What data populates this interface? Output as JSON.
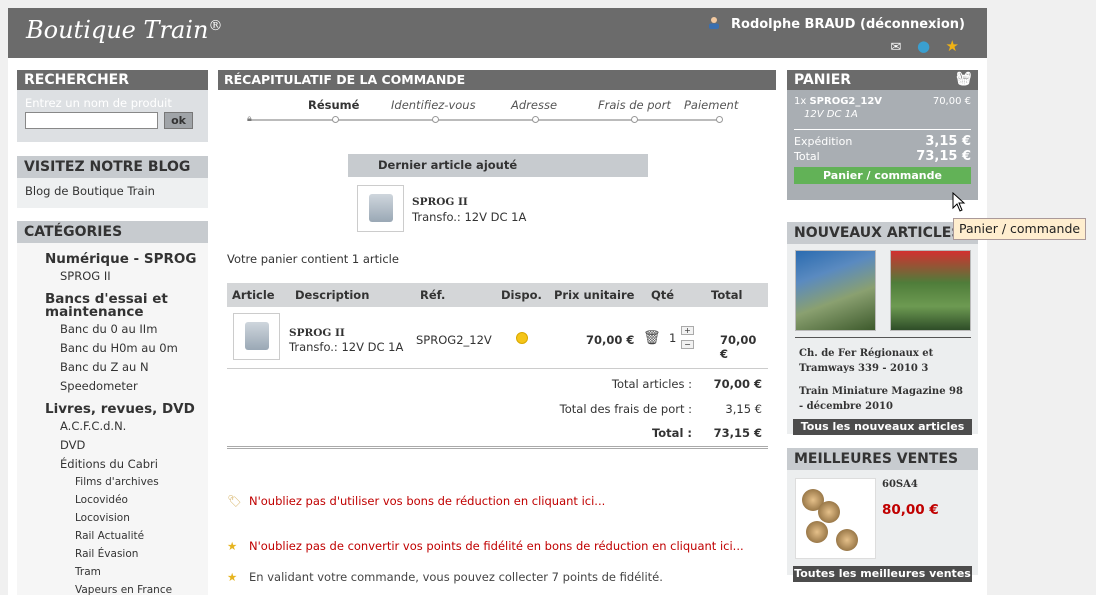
{
  "header": {
    "logo": "Boutique Train",
    "logo_mark": "®",
    "user_name": "Rodolphe BRAUD",
    "logout": "(déconnexion)",
    "icons": [
      "user-icon",
      "mail-icon",
      "globe-icon",
      "star-icon"
    ]
  },
  "search": {
    "title": "RECHERCHER",
    "label": "Entrez un nom de produit",
    "value": "",
    "button": "ok"
  },
  "blog": {
    "title": "VISITEZ NOTRE BLOG",
    "link": "Blog de Boutique Train"
  },
  "categories": {
    "title": "CATÉGORIES",
    "items": [
      {
        "label": "Numérique - SPROG",
        "level": 1
      },
      {
        "label": "SPROG II",
        "level": 2
      },
      {
        "label": "Bancs d'essai et maintenance",
        "level": 1
      },
      {
        "label": "Banc du 0 au IIm",
        "level": 2
      },
      {
        "label": "Banc du H0m au 0m",
        "level": 2
      },
      {
        "label": "Banc du Z au N",
        "level": 2
      },
      {
        "label": "Speedometer",
        "level": 2
      },
      {
        "label": "Livres, revues, DVD",
        "level": 1
      },
      {
        "label": "A.C.F.C.d.N.",
        "level": 2
      },
      {
        "label": "DVD",
        "level": 2
      },
      {
        "label": "Éditions du Cabri",
        "level": 2
      },
      {
        "label": "Films d'archives",
        "level": 3
      },
      {
        "label": "Locovidéo",
        "level": 3
      },
      {
        "label": "Locovision",
        "level": 3
      },
      {
        "label": "Rail Actualité",
        "level": 3
      },
      {
        "label": "Rail Évasion",
        "level": 3
      },
      {
        "label": "Tram",
        "level": 3
      },
      {
        "label": "Vapeurs en France",
        "level": 3
      }
    ]
  },
  "summary": {
    "title": "RÉCAPITULATIF DE LA COMMANDE",
    "steps": [
      "Résumé",
      "Identifiez-vous",
      "Adresse",
      "Frais de port",
      "Paiement"
    ],
    "last_added_title": "Dernier article ajouté",
    "last_added_name": "SPROG II",
    "last_added_desc": "Transfo.: 12V DC 1A",
    "cart_count": "Votre panier contient 1 article",
    "columns": [
      "Article",
      "Description",
      "Réf.",
      "Dispo.",
      "Prix unitaire",
      "Qté",
      "Total"
    ],
    "row": {
      "name": "SPROG II",
      "desc": "Transfo.: 12V DC 1A",
      "ref": "SPROG2_12V",
      "price": "70,00 €",
      "qty": "1",
      "total": "70,00 €"
    },
    "totals": {
      "articles_label": "Total articles :",
      "articles_value": "70,00 €",
      "shipping_label": "Total des frais de port :",
      "shipping_value": "3,15 €",
      "total_label": "Total :",
      "total_value": "73,15 €"
    },
    "msg_vouchers": "N'oubliez pas d'utiliser vos bons de réduction en cliquant ici...",
    "msg_points": "N'oubliez pas de convertir vos points de fidélité en bons de réduction en cliquant ici...",
    "msg_collect": "En validant votre commande, vous pouvez collecter 7 points de fidélité."
  },
  "cart": {
    "title": "PANIER",
    "qty_line": "1x",
    "item": "SPROG2_12V",
    "item_price": "70,00 €",
    "item_desc": "12V DC 1A",
    "shipping_label": "Expédition",
    "shipping_value": "3,15 €",
    "total_label": "Total",
    "total_value": "73,15 €",
    "button": "Panier / commande"
  },
  "new_articles": {
    "title": "NOUVEAUX ARTICLES",
    "item1": "Ch. de Fer Régionaux et Tramways 339 - 2010 3",
    "item2": "Train Miniature Magazine 98 - décembre 2010",
    "button": "Tous les nouveaux articles"
  },
  "best_sellers": {
    "title": "MEILLEURES VENTES",
    "item_name": "60SA4",
    "item_price": "80,00 €",
    "button": "Toutes les meilleures ventes"
  },
  "tooltip": "Panier / commande",
  "colors": {
    "header_bg": "#6b6b6b",
    "cart_button": "#62b257",
    "warning_red": "#c00000"
  }
}
